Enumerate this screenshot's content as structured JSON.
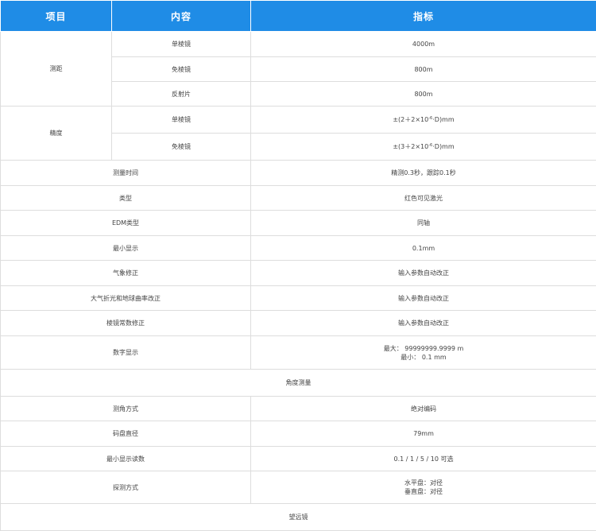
{
  "header": {
    "item": "项目",
    "content": "内容",
    "spec": "指标"
  },
  "range": {
    "label": "测距",
    "rows": [
      {
        "content": "单棱镜",
        "value": "4000m"
      },
      {
        "content": "免棱镜",
        "value": "800m"
      },
      {
        "content": "反射片",
        "value": "800m"
      }
    ]
  },
  "accuracy": {
    "label": "精度",
    "rows": [
      {
        "content": "单棱镜",
        "value_pre": "±(2＋2×10",
        "value_sup": "-6",
        "value_post": "·D)mm"
      },
      {
        "content": "免棱镜",
        "value_pre": "±(3＋2×10",
        "value_sup": "-6",
        "value_post": "·D)mm"
      }
    ]
  },
  "rows_a": [
    {
      "label": "测量时间",
      "value": "精测0.3秒，跟踪0.1秒"
    },
    {
      "label": "类型",
      "value": "红色可见激光"
    },
    {
      "label": "EDM类型",
      "value": "同轴"
    },
    {
      "label": "最小显示",
      "value": "0.1mm"
    },
    {
      "label": "气象修正",
      "value": "输入参数自动改正"
    },
    {
      "label": "大气折光和地球曲率改正",
      "value": "输入参数自动改正"
    },
    {
      "label": "棱镜常数修正",
      "value": "输入参数自动改正"
    }
  ],
  "digital_display": {
    "label": "数字显示",
    "line1": "最大：  99999999.9999 m",
    "line2": "最小：  0.1 mm"
  },
  "section_angle": "角度测量",
  "rows_b": [
    {
      "label": "测角方式",
      "value": "绝对编码"
    },
    {
      "label": "码盘直径",
      "value": "79mm"
    },
    {
      "label": "最小显示读数",
      "value": "0.1 / 1 / 5 / 10 可选"
    }
  ],
  "detection": {
    "label": "探测方式",
    "line1": "水平盘：对径",
    "line2": "垂直盘：对径"
  },
  "section_telescope": "望远镜"
}
